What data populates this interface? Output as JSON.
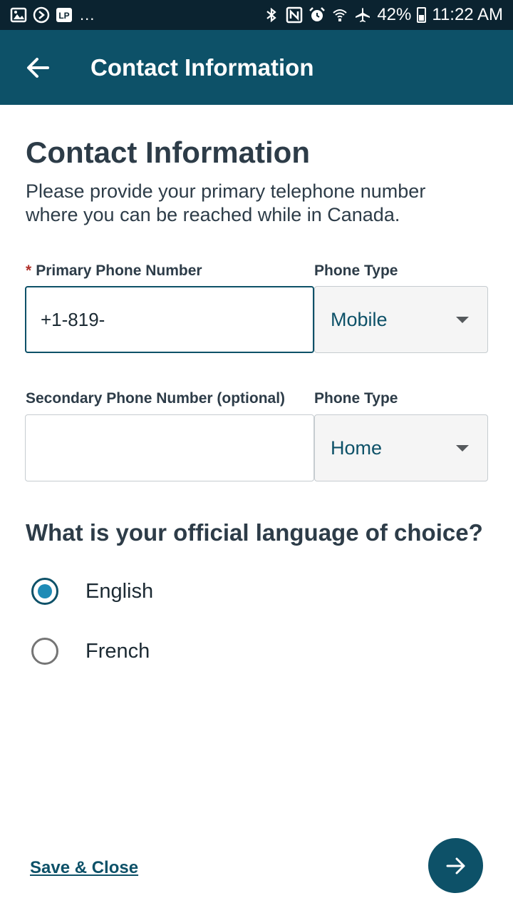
{
  "status_bar": {
    "battery": "42%",
    "time": "11:22 AM",
    "overflow": "...",
    "icons": [
      "image-icon",
      "sync-icon",
      "lp-icon",
      "bluetooth-icon",
      "nfc-icon",
      "alarm-icon",
      "wifi-icon",
      "airplane-icon",
      "battery-icon"
    ],
    "lp_label": "LP"
  },
  "app_bar": {
    "title": "Contact Information",
    "back_icon": "arrow-left-icon"
  },
  "main": {
    "heading": "Contact Information",
    "description": "Please provide your primary telephone number where you can be reached while in Canada.",
    "primary_phone": {
      "required_marker": "*",
      "label": "Primary Phone Number",
      "value": "+1-819-",
      "type_label": "Phone Type",
      "type_value": "Mobile"
    },
    "secondary_phone": {
      "label": "Secondary Phone Number (optional)",
      "value": "",
      "type_label": "Phone Type",
      "type_value": "Home"
    },
    "language": {
      "question": "What is your official language of choice?",
      "options": [
        {
          "label": "English",
          "selected": true
        },
        {
          "label": "French",
          "selected": false
        }
      ]
    }
  },
  "footer": {
    "save_close": "Save & Close",
    "next_icon": "arrow-right-icon"
  },
  "colors": {
    "status_bar": "#0b2330",
    "app_bar": "#0d5168",
    "text": "#2d3c48",
    "required": "#b0322c",
    "radio_selected": "#1e8bb6",
    "select_bg": "#f5f5f5"
  }
}
